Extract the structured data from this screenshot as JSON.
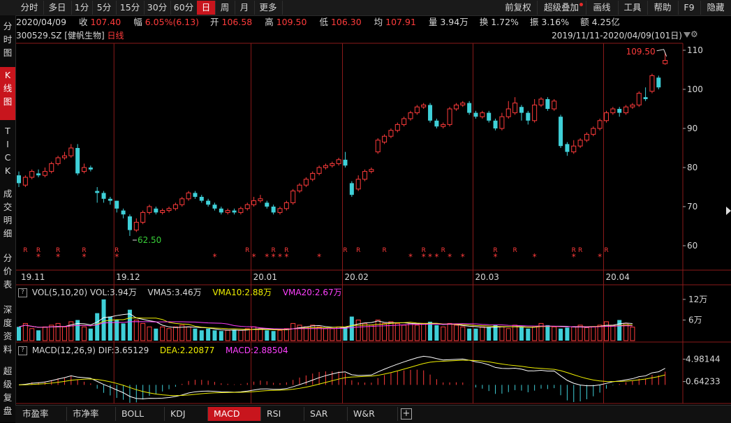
{
  "toolbar": {
    "left_items": [
      {
        "label": "分时",
        "active": false
      },
      {
        "label": "多日",
        "active": false
      },
      {
        "label": "1分",
        "active": false
      },
      {
        "label": "5分",
        "active": false
      },
      {
        "label": "15分",
        "active": false
      },
      {
        "label": "30分",
        "active": false
      },
      {
        "label": "60分",
        "active": false
      },
      {
        "label": "日",
        "active": true
      },
      {
        "label": "周",
        "active": false
      },
      {
        "label": "月",
        "active": false
      },
      {
        "label": "更多",
        "active": false
      }
    ],
    "right_items": [
      {
        "label": "前复权"
      },
      {
        "label": "超级叠加"
      },
      {
        "label": "画线"
      },
      {
        "label": "工具"
      },
      {
        "label": "帮助"
      },
      {
        "label": "F9"
      },
      {
        "label": "隐藏"
      }
    ]
  },
  "left_tabs": [
    {
      "label": "分\n时\n图",
      "active": false
    },
    {
      "label": "K\n线\n图",
      "active": true
    },
    {
      "label": "T\nI\nC\nK",
      "active": false
    },
    {
      "label": "成\n交\n明\n细",
      "active": false
    },
    {
      "label": "分\n价\n表",
      "active": false
    },
    {
      "label": "深\n度\n资\n料",
      "active": false
    },
    {
      "label": "超\n级\n复\n盘",
      "active": false
    }
  ],
  "info": {
    "date": "2020/04/09",
    "close_label": "收",
    "close": "107.40",
    "change_label": "幅",
    "change": "6.05%(6.13)",
    "open_label": "开",
    "open": "106.58",
    "high_label": "高",
    "high": "109.50",
    "low_label": "低",
    "low": "106.30",
    "avg_label": "均",
    "avg": "107.91",
    "volume_label": "量",
    "volume": "3.94万",
    "turnover_label": "换",
    "turnover": "1.72%",
    "amplitude_label": "振",
    "amplitude": "3.16%",
    "amount_label": "额",
    "amount": "4.25亿"
  },
  "title": {
    "code": "300529.SZ",
    "name": "[健帆生物]",
    "period": "日线"
  },
  "date_range": "2019/11/11-2020/04/09(101日)",
  "colors": {
    "up": "#ff3b3b",
    "down": "#3fd0d8",
    "grid": "#8a1a1a",
    "ma5": "#ffffff",
    "ma10": "#f0f000",
    "ma20": "#ff40ff"
  },
  "chart_data": {
    "type": "candlestick",
    "y_ticks": [
      "110",
      "100",
      "90",
      "80",
      "70",
      "60"
    ],
    "ylim": [
      57,
      113
    ],
    "x_ticks": [
      {
        "label": "19.11",
        "i": 0
      },
      {
        "label": "19.12",
        "i": 15
      },
      {
        "label": "20.01",
        "i": 36
      },
      {
        "label": "20.02",
        "i": 50
      },
      {
        "label": "20.03",
        "i": 70
      },
      {
        "label": "20.04",
        "i": 90
      }
    ],
    "annotations": {
      "high": "109.50",
      "low": "62.50"
    },
    "candles": [
      [
        78,
        76,
        79,
        75
      ],
      [
        75.5,
        77.5,
        78,
        75
      ],
      [
        77.5,
        79,
        79.5,
        77
      ],
      [
        78.5,
        78,
        79.5,
        77.5
      ],
      [
        78,
        79,
        80,
        77.5
      ],
      [
        79,
        81,
        81.5,
        78.5
      ],
      [
        81,
        82.5,
        83,
        80.5
      ],
      [
        82.5,
        83,
        84,
        82
      ],
      [
        83,
        85,
        86,
        82.5
      ],
      [
        85,
        78.5,
        86,
        78
      ],
      [
        79,
        80,
        81,
        78.5
      ],
      [
        80,
        79.5,
        80.5,
        79
      ],
      [
        74,
        73.5,
        75,
        71
      ],
      [
        73.5,
        72,
        74,
        71
      ],
      [
        72,
        71.5,
        72.5,
        70.5
      ],
      [
        71.5,
        69.5,
        71.5,
        68.5
      ],
      [
        69,
        68,
        69.5,
        67
      ],
      [
        67.5,
        64,
        68,
        62.5
      ],
      [
        64,
        66,
        67,
        63.5
      ],
      [
        66,
        68.5,
        69,
        65.5
      ],
      [
        68.5,
        70,
        70.5,
        68
      ],
      [
        69.5,
        68.5,
        70,
        68
      ],
      [
        68.5,
        69,
        69.5,
        68
      ],
      [
        69,
        69.5,
        70,
        68.5
      ],
      [
        69.5,
        70.5,
        71,
        69
      ],
      [
        70.5,
        72,
        72.5,
        70
      ],
      [
        72,
        73.5,
        74,
        71.5
      ],
      [
        73.5,
        72.5,
        74,
        72
      ],
      [
        72.5,
        71.5,
        73,
        71
      ],
      [
        71.5,
        70.5,
        72,
        70
      ],
      [
        70.5,
        69.5,
        71,
        69
      ],
      [
        69.5,
        68.5,
        70,
        68
      ],
      [
        68.5,
        69,
        69.5,
        68
      ],
      [
        69,
        68.5,
        69.5,
        68
      ],
      [
        68.5,
        69.5,
        70,
        68
      ],
      [
        69.5,
        70.5,
        71,
        69
      ],
      [
        70.5,
        71.5,
        72.5,
        70
      ],
      [
        71.5,
        72,
        73,
        71
      ],
      [
        71,
        70,
        71.5,
        69.5
      ],
      [
        70,
        68.5,
        70.5,
        68
      ],
      [
        68.5,
        69.5,
        70,
        68
      ],
      [
        69.5,
        71,
        71.5,
        69
      ],
      [
        71,
        74,
        74.5,
        70.5
      ],
      [
        74,
        75.5,
        76,
        73.5
      ],
      [
        75.5,
        77,
        77.5,
        75
      ],
      [
        77,
        78.5,
        79,
        76.5
      ],
      [
        78.5,
        80,
        80.5,
        78
      ],
      [
        80,
        80.5,
        81,
        79.5
      ],
      [
        80.5,
        81,
        81.5,
        80
      ],
      [
        81,
        82,
        82.5,
        80.5
      ],
      [
        82,
        80.5,
        84,
        80
      ],
      [
        76,
        73,
        76.5,
        72.5
      ],
      [
        74.5,
        77,
        78,
        74
      ],
      [
        77,
        79,
        79.5,
        76.5
      ],
      [
        79,
        79.5,
        80,
        78.5
      ],
      [
        84,
        87,
        87.5,
        83.5
      ],
      [
        86.5,
        88,
        88.5,
        86
      ],
      [
        88,
        89.5,
        90,
        87.5
      ],
      [
        89.5,
        91,
        91.5,
        89
      ],
      [
        91,
        92.5,
        93,
        90.5
      ],
      [
        92.5,
        94,
        94.5,
        92
      ],
      [
        94,
        95.5,
        96,
        93.5
      ],
      [
        95.5,
        96,
        96.5,
        95
      ],
      [
        96,
        92,
        96.5,
        91.5
      ],
      [
        92,
        90.5,
        92.5,
        90
      ],
      [
        90.5,
        91,
        91.5,
        90
      ],
      [
        91,
        95,
        95.5,
        90.5
      ],
      [
        95,
        96,
        96.5,
        94.5
      ],
      [
        96,
        96.5,
        97,
        95.5
      ],
      [
        96.5,
        94,
        97,
        93.5
      ],
      [
        94,
        93,
        94.5,
        92.5
      ],
      [
        93,
        94,
        94.5,
        92.5
      ],
      [
        94,
        92,
        94.5,
        91.5
      ],
      [
        92,
        90,
        92.5,
        89.5
      ],
      [
        90,
        93,
        94,
        89.5
      ],
      [
        93,
        95,
        97,
        92.5
      ],
      [
        94,
        96.5,
        98,
        93.5
      ],
      [
        95.5,
        94,
        96,
        92
      ],
      [
        94,
        92,
        94.5,
        91
      ],
      [
        92,
        96,
        97.5,
        91.5
      ],
      [
        96,
        97.5,
        98,
        95.5
      ],
      [
        97.5,
        95,
        98,
        94.5
      ],
      [
        95,
        97,
        97.5,
        94.5
      ],
      [
        93,
        85.5,
        93.5,
        85
      ],
      [
        86,
        84,
        86.5,
        83
      ],
      [
        84,
        85.5,
        87,
        83.5
      ],
      [
        85.5,
        87,
        87.5,
        85
      ],
      [
        87,
        88.5,
        89,
        86.5
      ],
      [
        88.5,
        90,
        90.5,
        88
      ],
      [
        90,
        92,
        92.5,
        89.5
      ],
      [
        92,
        94,
        94.5,
        91.5
      ],
      [
        94,
        95,
        95.5,
        93.5
      ],
      [
        95,
        94,
        95.5,
        93
      ],
      [
        94,
        95.5,
        96,
        93.5
      ],
      [
        95.5,
        96,
        96.5,
        95
      ],
      [
        96,
        99,
        99.5,
        95.5
      ],
      [
        98,
        97.5,
        100.5,
        97
      ],
      [
        99.5,
        103.5,
        104,
        99
      ],
      [
        103,
        100.5,
        103.5,
        100
      ],
      [
        106.58,
        107.4,
        109.5,
        106.3
      ]
    ],
    "markers": {
      "R": [
        1,
        3,
        6,
        10,
        15,
        35,
        39,
        41,
        50,
        52,
        56,
        62,
        65,
        73,
        76,
        85,
        86,
        90
      ],
      "star": [
        3,
        6,
        10,
        15,
        30,
        36,
        38,
        39,
        40,
        41,
        46,
        60,
        62,
        63,
        64,
        66,
        68,
        73,
        79,
        85,
        89
      ]
    },
    "volume_panel": {
      "label": "VOL(5,10,20)",
      "vol": "VOL:3.94万",
      "vma5": "VMA5:3.46万",
      "vma10": "VMA10:2.88万",
      "vma20": "VMA20:2.67万",
      "y_ticks": [
        "12万",
        "6万"
      ],
      "ylim": [
        0,
        13
      ],
      "values": [
        4,
        5,
        3.5,
        3,
        4,
        4.5,
        5,
        4,
        5.5,
        6,
        4,
        3.5,
        8,
        12,
        7,
        6,
        5,
        9,
        6,
        5,
        4,
        3.5,
        4,
        3.5,
        4,
        4.5,
        4,
        3.5,
        3,
        3.5,
        3,
        2.8,
        3,
        3.2,
        3,
        3.5,
        4,
        3.5,
        3,
        2.8,
        3,
        3.5,
        5,
        4.5,
        4,
        4.5,
        4,
        3.5,
        3.5,
        4,
        3.8,
        7,
        6,
        5,
        4.5,
        6,
        5,
        5.5,
        5,
        4.5,
        5,
        4.5,
        5,
        5.5,
        4.5,
        4,
        5,
        4.5,
        4,
        3.5,
        3.5,
        4,
        4,
        4.5,
        4,
        3.5,
        4.5,
        4,
        3.5,
        4,
        5,
        4.5,
        4,
        3.5,
        3.8,
        4,
        4.5,
        3.8,
        4,
        4.5,
        5.5,
        4.5,
        6,
        5,
        3.94
      ]
    },
    "macd_panel": {
      "label": "MACD(12,26,9)",
      "dif": "DIF:3.65129",
      "dea": "DEA:2.20877",
      "macd": "MACD:2.88504",
      "y_ticks": [
        "4.98144",
        "0.64233"
      ],
      "ylim": [
        -3.6,
        5.6
      ]
    }
  },
  "bottom_tabs": [
    {
      "label": "市盈率",
      "active": false
    },
    {
      "label": "市净率",
      "active": false
    },
    {
      "label": "BOLL",
      "active": false
    },
    {
      "label": "KDJ",
      "active": false
    },
    {
      "label": "MACD",
      "active": true
    },
    {
      "label": "RSI",
      "active": false
    },
    {
      "label": "SAR",
      "active": false
    },
    {
      "label": "W&R",
      "active": false
    }
  ]
}
